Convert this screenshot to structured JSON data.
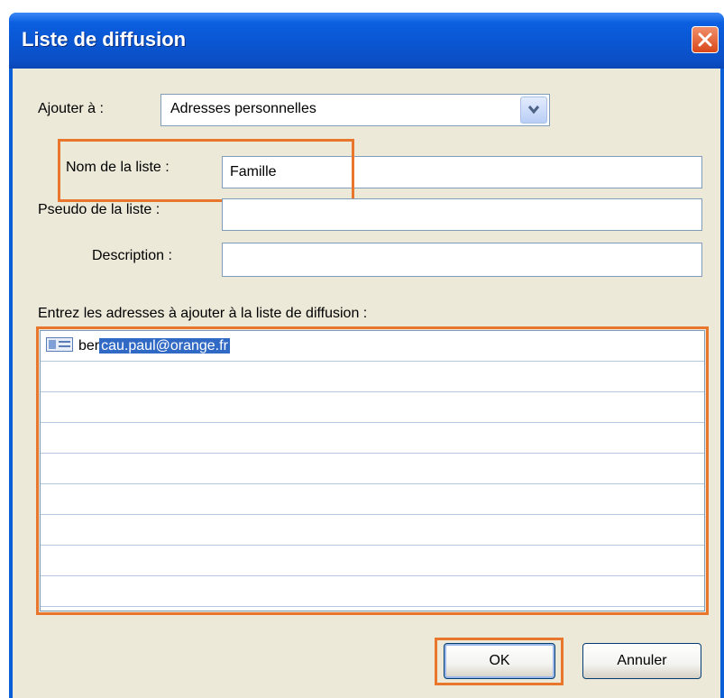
{
  "window": {
    "title": "Liste de diffusion"
  },
  "form": {
    "add_to_label": "Ajouter à :",
    "add_to_value": "Adresses personnelles",
    "list_name_label": "Nom de la liste :",
    "list_name_value": "Famille",
    "list_alias_label": "Pseudo de la liste :",
    "list_alias_value": "",
    "description_label": "Description :",
    "description_value": "",
    "addresses_label": "Entrez les adresses à ajouter à la liste de diffusion :"
  },
  "addresses": {
    "entry_prefix": "ber",
    "entry_selected": "cau.paul@orange.fr"
  },
  "buttons": {
    "ok": "OK",
    "cancel": "Annuler"
  },
  "colors": {
    "titlebar": "#0a56d2",
    "dialog_bg": "#ece9d8",
    "highlight": "#e8772d",
    "selection": "#316ac5"
  },
  "icons": {
    "close": "close-icon",
    "dropdown": "chevron-down-icon",
    "contact": "contact-card-icon"
  }
}
